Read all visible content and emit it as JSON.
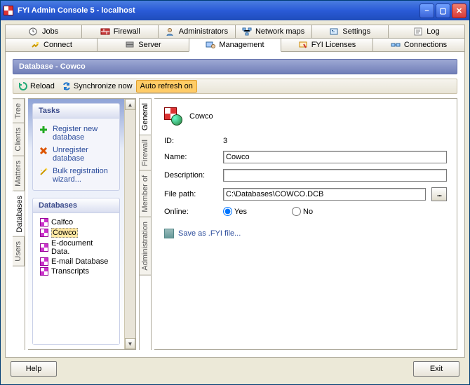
{
  "window": {
    "title": "FYI Admin Console 5 - localhost"
  },
  "topTabs": {
    "row1": [
      "Jobs",
      "Firewall",
      "Administrators",
      "Network maps",
      "Settings",
      "Log"
    ],
    "row2": [
      "Connect",
      "Server",
      "Management",
      "FYI Licenses",
      "Connections"
    ]
  },
  "db": {
    "header": "Database - Cowco",
    "toolbar": {
      "reload": "Reload",
      "sync": "Synchronize now",
      "auto": "Auto refresh on"
    }
  },
  "leftTabs": [
    "Tree",
    "Clients",
    "Matters",
    "Databases",
    "Users"
  ],
  "tasks": {
    "title": "Tasks",
    "items": [
      "Register new database",
      "Unregister database",
      "Bulk registration wizard..."
    ]
  },
  "listPanel": {
    "title": "Databases",
    "items": [
      "Calfco",
      "Cowco",
      "E-document Data.",
      "E-mail Database",
      "Transcripts"
    ],
    "selectedIndex": 1
  },
  "midTabs": [
    "General",
    "Firewall",
    "Member of",
    "Administration"
  ],
  "detail": {
    "title": "Cowco",
    "labels": {
      "id": "ID:",
      "name": "Name:",
      "desc": "Description:",
      "path": "File path:",
      "online": "Online:"
    },
    "id": "3",
    "name": "Cowco",
    "description": "",
    "path": "C:\\Databases\\COWCO.DCB",
    "online": "Yes",
    "yes": "Yes",
    "no": "No",
    "saveAs": "Save as .FYI file..."
  },
  "footer": {
    "help": "Help",
    "exit": "Exit"
  }
}
